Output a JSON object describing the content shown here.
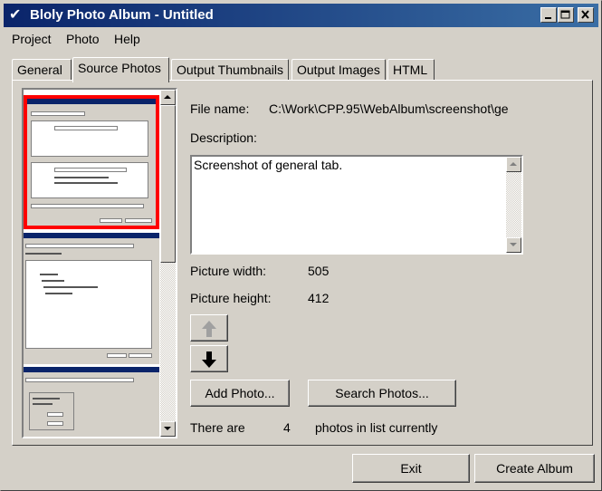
{
  "window": {
    "title": "Bloly Photo Album - Untitled"
  },
  "menu": [
    "Project",
    "Photo",
    "Help"
  ],
  "tabs": [
    {
      "label": "General",
      "active": false
    },
    {
      "label": "Source Photos",
      "active": true
    },
    {
      "label": "Output Thumbnails",
      "active": false
    },
    {
      "label": "Output Images",
      "active": false
    },
    {
      "label": "HTML",
      "active": false
    }
  ],
  "details": {
    "file_name_label": "File name:",
    "file_name_value": "C:\\Work\\CPP.95\\WebAlbum\\screenshot\\ge",
    "description_label": "Description:",
    "description_value": "Screenshot of general tab.",
    "width_label": "Picture width:",
    "width_value": "505",
    "height_label": "Picture height:",
    "height_value": "412"
  },
  "buttons": {
    "add_photo": "Add Photo...",
    "search_photos": "Search Photos...",
    "exit": "Exit",
    "create_album": "Create Album"
  },
  "status": {
    "prefix": "There are",
    "count": "4",
    "suffix": "photos in list currently"
  },
  "colors": {
    "selection_border": "#ff0000",
    "title_bar": "#0a246a"
  }
}
